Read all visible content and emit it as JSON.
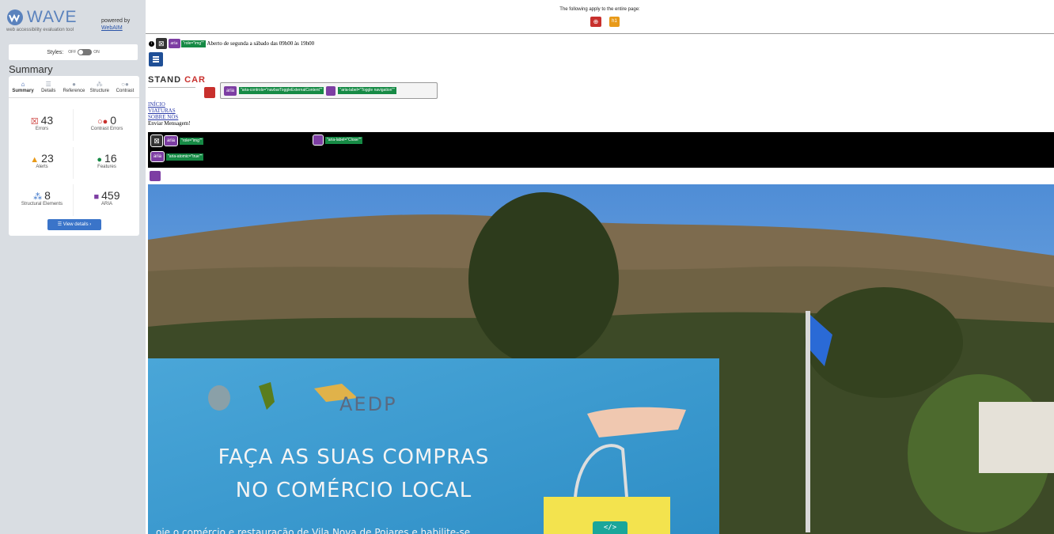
{
  "sidebar": {
    "logo_title": "WAVE",
    "logo_sub": "web accessibility evaluation tool",
    "powered_by": "powered by",
    "webaim": "WebAIM",
    "styles_label": "Styles:",
    "styles_off": "OFF",
    "styles_on": "ON",
    "summary_heading": "Summary",
    "tabs": [
      {
        "label": "Summary",
        "icon": "home-icon"
      },
      {
        "label": "Details",
        "icon": "list-icon"
      },
      {
        "label": "Reference",
        "icon": "info-icon"
      },
      {
        "label": "Structure",
        "icon": "hierarchy-icon"
      },
      {
        "label": "Contrast",
        "icon": "contrast-icon"
      }
    ],
    "stats": {
      "errors": {
        "value": "43",
        "label": "Errors",
        "color": "#c8302d"
      },
      "contrast_errors": {
        "value": "0",
        "label": "Contrast Errors",
        "color": "#c8302d"
      },
      "alerts": {
        "value": "23",
        "label": "Alerts",
        "color": "#e89a19"
      },
      "features": {
        "value": "16",
        "label": "Features",
        "color": "#168a45"
      },
      "structural": {
        "value": "8",
        "label": "Structural Elements",
        "color": "#3a74c9"
      },
      "aria": {
        "value": "459",
        "label": "ARIA",
        "color": "#7d3ea3"
      }
    },
    "view_details": "View details ›"
  },
  "topbar": {
    "text": "The following apply to the entire page:"
  },
  "page": {
    "opening_hours": "Aberto de segunda a sábado das 09h00 às 19h00",
    "aria": "aria",
    "role_img": "\"role=\"img\"\"",
    "brand_stand": "STAND ",
    "brand_car": "CAR",
    "aria_controls": "\"aria-controls=\"navbarToggleExternalContent\"\"",
    "aria_label_toggle": "\"aria-label=\"Toggle navigation\"\"",
    "nav": [
      "INÍCIO",
      "VIATURAS",
      "SOBRE NÓS"
    ],
    "nav_plain": "Enviar Mensagem!",
    "aria_label_close": "\"aria-label=\"Close\"\"",
    "aria_atomic": "\"aria-atomic=\"true\"\"",
    "billboard": {
      "aedp": "AEDP",
      "line1": "FAÇA AS SUAS COMPRAS",
      "line2": "NO COMÉRCIO LOCAL",
      "footer": "oie o comércio e restauração de Vila Nova de Poiares e habilite-se"
    },
    "code_badge": "</>"
  },
  "colors": {
    "accent": "#2a54a8",
    "error": "#c8302d",
    "alert": "#e89a19",
    "feature": "#168a45",
    "aria": "#7d3ea3"
  }
}
